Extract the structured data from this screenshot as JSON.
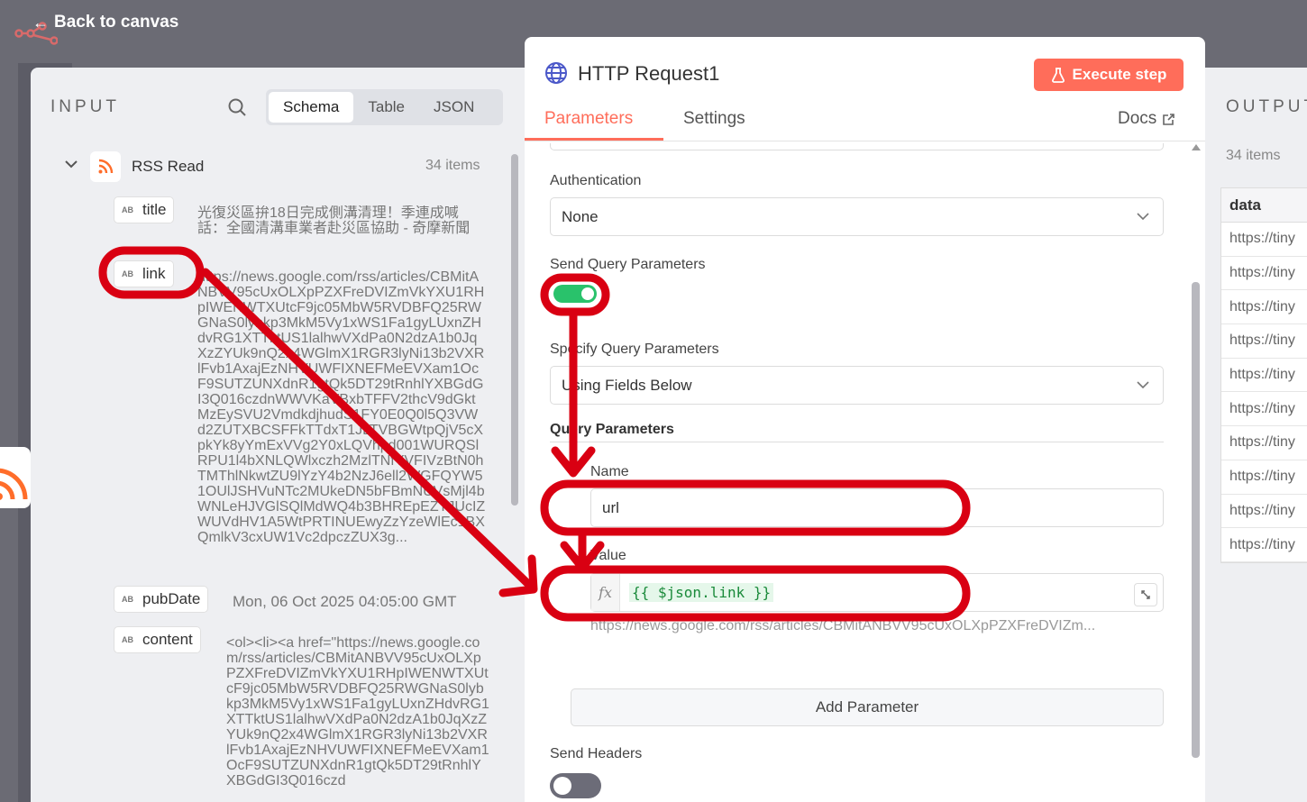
{
  "topbar": {
    "back_label": "Back to canvas"
  },
  "input": {
    "title": "INPUT",
    "tabs": [
      "Schema",
      "Table",
      "JSON"
    ],
    "node_name": "RSS Read",
    "item_count": "34 items",
    "fields": [
      {
        "name": "title",
        "value": "光復災區拚18日完成側溝清理！季連成喊話：全國清溝車業者赴災區協助 - 奇摩新聞"
      },
      {
        "name": "link",
        "value": "https://news.google.com/rss/articles/CBMitANBVV95cUxOLXpPZXFreDVIZmVkYXU1RHpIWENWTXUtcF9jc05MbW5RVDBFQ25RWGNaS0lybkp3MkM5Vy1xWS1Fa1gyLUxnZHdvRG1XTTktUS1lalhwVXdPa0N2dzA1b0JqXzZYUk9nQ2x4WGlmX1RGR3lyNi13b2VXRlFvb1AxajEzNHVUWFIXNEFMeEVXam1OcF9SUTZUNXdnR1gtQk5DT29tRnhlYXBGdGI3Q016czdnWWVKaVBxbTFFV2thcV9dGktMzEySVU2VmdkdjhudS1FY0E0Q0l5Q3VWd2ZUTXBCSFFkTTdxT1JLTVBGWtpQjV5cXpkYk8yYmExVVg2Y0xLQVhpd001WURQSlRPU1l4bXNLQWlxczh2MzlTNfYVFIVzBtN0hTMThlNkwtZU9lYzY4b2NzJ6ell2WGFQYW51OUlJSHVuNTc2MUkeDN5bFBmNUVsMjl4bWNLeHJVGlSQlMdWQ4b3BHREpEZTJUcIZWUVdHV1A5WtPRTINUEwyZzYzeWlEc1BXQmlkV3cxUW1Vc2dpczZUX3g..."
      },
      {
        "name": "pubDate",
        "value": "Mon, 06 Oct 2025 04:05:00 GMT"
      },
      {
        "name": "content",
        "value": "<ol><li><a href=\"https://news.google.com/rss/articles/CBMitANBVV95cUxOLXpPZXFreDVIZmVkYXU1RHpIWENWTXUtcF9jc05MbW5RVDBFQ25RWGNaS0lybkp3MkM5Vy1xWS1Fa1gyLUxnZHdvRG1XTTktUS1lalhwVXdPa0N2dzA1b0JqXzZYUk9nQ2x4WGlmX1RGR3lyNi13b2VXRlFvb1AxajEzNHVUWFIXNEFMeEVXam1OcF9SUTZUNXdnR1gtQk5DT29tRnhlYXBGdGI3Q016czd"
      }
    ]
  },
  "node": {
    "title": "HTTP Request1",
    "execute_label": "Execute step",
    "tabs": {
      "parameters": "Parameters",
      "settings": "Settings",
      "docs": "Docs"
    },
    "authentication": {
      "label": "Authentication",
      "value": "None"
    },
    "send_query": {
      "label": "Send Query Parameters",
      "enabled": true
    },
    "specify_query": {
      "label": "Specify Query Parameters",
      "value": "Using Fields Below"
    },
    "query_params": {
      "label": "Query Parameters",
      "name_label": "Name",
      "name_value": "url",
      "value_label": "Value",
      "value_expr": "{{ $json.link }}",
      "value_preview": "https://news.google.com/rss/articles/CBMitANBVV95cUxOLXpPZXFreDVIZm..."
    },
    "add_param_label": "Add Parameter",
    "send_headers": {
      "label": "Send Headers",
      "enabled": false
    }
  },
  "output": {
    "title": "OUTPUT",
    "item_count": "34 items",
    "column": "data",
    "rows": [
      "https://tiny",
      "https://tiny",
      "https://tiny",
      "https://tiny",
      "https://tiny",
      "https://tiny",
      "https://tiny",
      "https://tiny",
      "https://tiny",
      "https://tiny"
    ]
  },
  "colors": {
    "accent": "#ff6d5a",
    "toggle_on": "#29c26b",
    "annotation": "#d90012"
  }
}
